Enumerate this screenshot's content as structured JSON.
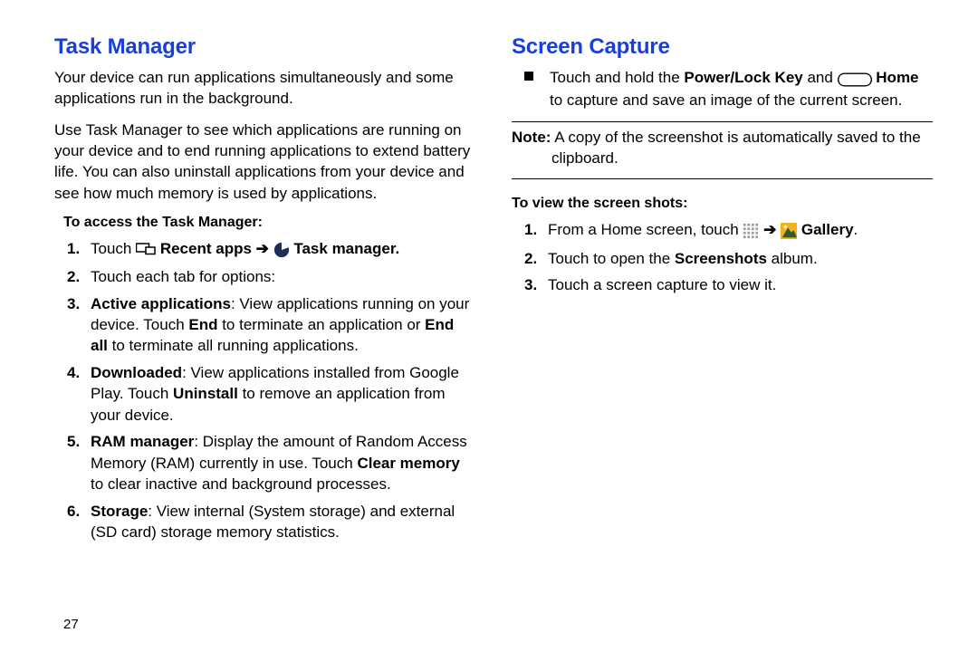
{
  "page_number": "27",
  "left": {
    "title": "Task Manager",
    "p1": "Your device can run applications simultaneously and some applications run in the background.",
    "p2": "Use Task Manager to see which applications are running on your device and to end running applications to extend battery life. You can also uninstall applications from your device and see how much memory is used by applications.",
    "sub": "To access the Task Manager:",
    "li1_touch": "Touch ",
    "li1_recent": " Recent apps ",
    "li1_arrow": "➔",
    "li1_taskmgr": " Task manager.",
    "li2": "Touch each tab for options:",
    "li3_lead": "Active applications",
    "li3_text1": ": View applications running on your device. Touch ",
    "li3_end": "End",
    "li3_text2": " to terminate an application or ",
    "li3_endall": "End all",
    "li3_text3": " to terminate all running applications.",
    "li4_lead": "Downloaded",
    "li4_text1": ": View applications installed from Google Play. Touch ",
    "li4_uninstall": "Uninstall",
    "li4_text2": " to remove an application from your device.",
    "li5_lead": "RAM manager",
    "li5_text1": ": Display the amount of Random Access Memory (RAM) currently in use. Touch ",
    "li5_clear": "Clear memory",
    "li5_text2": " to clear inactive and background processes.",
    "li6_lead": "Storage",
    "li6_text": ": View internal (System storage) and external (SD card) storage memory statistics."
  },
  "right": {
    "title": "Screen Capture",
    "bul_pre": "Touch and hold the ",
    "bul_power": "Power/Lock Key",
    "bul_and": " and ",
    "bul_home": " Home",
    "bul_post": " to capture and save an image of the current screen.",
    "note_label": "Note:",
    "note_text1": " A copy of the screenshot is automatically saved to the",
    "note_text2": "clipboard.",
    "sub": "To view the screen shots:",
    "li1_pre": "From a Home screen, touch ",
    "li1_arrow": "➔",
    "li1_gallery": " Gallery",
    "li1_post": ".",
    "li2_pre": "Touch to open the ",
    "li2_ss": "Screenshots",
    "li2_post": " album.",
    "li3": "Touch a screen capture to view it."
  }
}
